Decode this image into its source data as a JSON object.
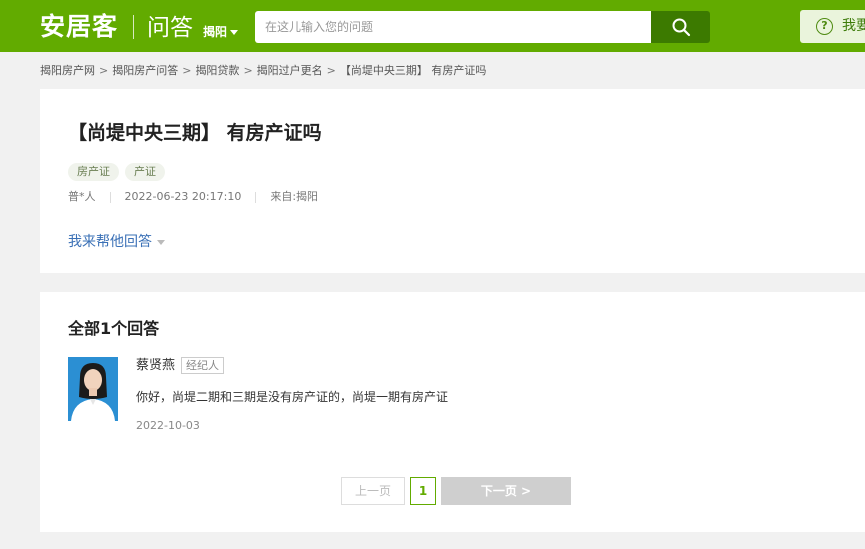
{
  "header": {
    "logo": "安居客",
    "section": "问答",
    "city": "揭阳",
    "search_placeholder": "在这儿输入您的问题",
    "ask_label": "我要提问"
  },
  "breadcrumb": [
    "揭阳房产网",
    "揭阳房产问答",
    "揭阳贷款",
    "揭阳过户更名",
    "【尚堤中央三期】 有房产证吗"
  ],
  "breadcrumb_sep": ">",
  "question": {
    "title": "【尚堤中央三期】 有房产证吗",
    "tags": [
      "房产证",
      "产证"
    ],
    "author": "普*人",
    "time": "2022-06-23 20:17:10",
    "source": "来自:揭阳",
    "help_label": "我来帮他回答"
  },
  "answers": {
    "count_label": "全部1个回答",
    "items": [
      {
        "name": "蔡贤燕",
        "badge": "经纪人",
        "text": "你好，尚堤二期和三期是没有房产证的，尚堤一期有房产证",
        "date": "2022-10-03"
      }
    ]
  },
  "pagination": {
    "prev": "上一页",
    "current": "1",
    "next": "下一页 >"
  },
  "colors": {
    "brand_green": "#62ab00",
    "link_blue": "#3a70b6"
  }
}
